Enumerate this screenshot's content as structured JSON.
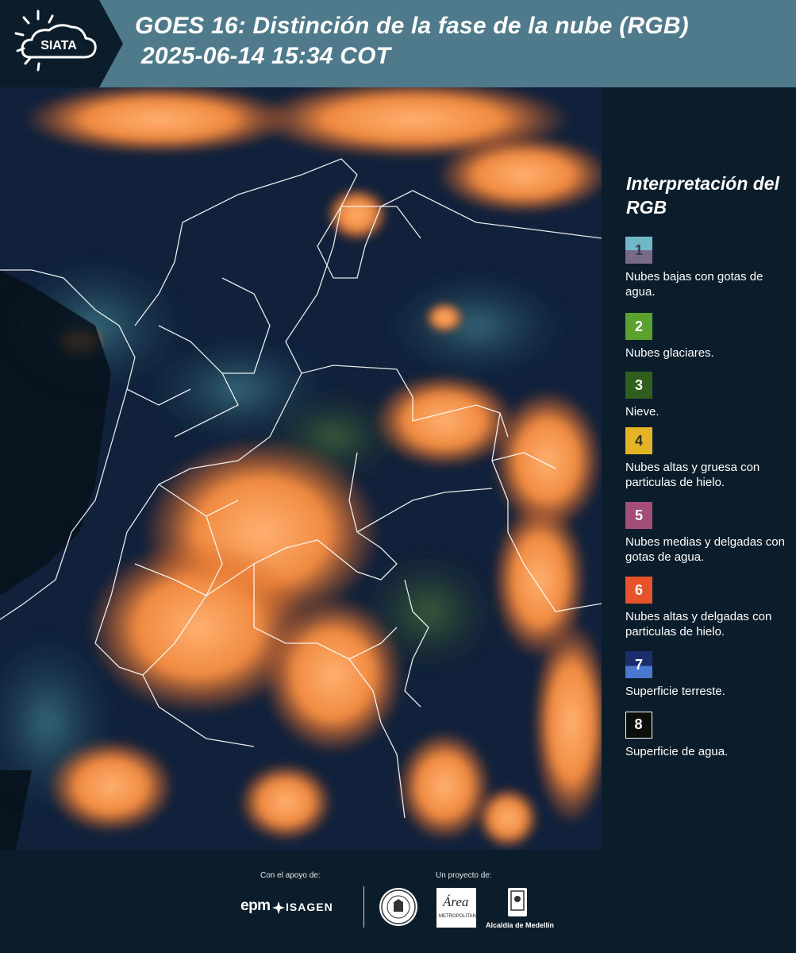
{
  "header": {
    "logo_text": "SIATA",
    "title_line1": "GOES 16: Distinción de la fase de la nube (RGB)",
    "title_line2": "2025-06-14 15:34 COT"
  },
  "legend": {
    "title": "Interpretación del RGB",
    "items": [
      {
        "num": "1",
        "label": "Nubes bajas con gotas de agua.",
        "color_top": "#6fb8c8",
        "color_bottom": "#7a6a8a"
      },
      {
        "num": "2",
        "label": "Nubes glaciares.",
        "color_top": "#5aa12f",
        "color_bottom": "#5aa12f"
      },
      {
        "num": "3",
        "label": "Nieve.",
        "color_top": "#2f5e1d",
        "color_bottom": "#2f5e1d"
      },
      {
        "num": "4",
        "label": "Nubes altas y gruesa con particulas de hielo.",
        "color_top": "#e3b423",
        "color_bottom": "#e3b423"
      },
      {
        "num": "5",
        "label": "Nubes medias y delgadas con gotas de agua.",
        "color_top": "#a34d7a",
        "color_bottom": "#a34d7a"
      },
      {
        "num": "6",
        "label": "Nubes altas y delgadas con particulas de hielo.",
        "color_top": "#e8522a",
        "color_bottom": "#e8522a"
      },
      {
        "num": "7",
        "label": "Superficie terreste.",
        "color_top": "#1b2d6b",
        "color_bottom": "#4a78d0"
      },
      {
        "num": "8",
        "label": "Superficie de agua.",
        "color_top": "#0b0f0c",
        "color_bottom": "#0b0f0c"
      }
    ]
  },
  "footer": {
    "support_label": "Con el apoyo de:",
    "project_label": "Un proyecto de:",
    "epm": "epm",
    "isagen": "ISAGEN",
    "area_text": "Área",
    "area_sub": "METROPOLITANA",
    "alcaldia": "Alcaldía de Medellín"
  }
}
